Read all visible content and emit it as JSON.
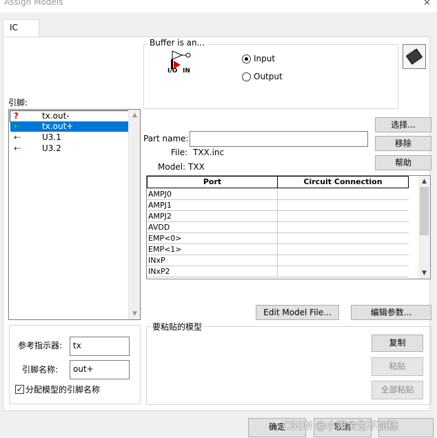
{
  "window": {
    "title": "Assign Models"
  },
  "tabs": [
    {
      "label": "IC"
    }
  ],
  "buffer": {
    "group_label": "Buffer is an...",
    "diagram_left_label": "I/O",
    "diagram_right_label": "IN",
    "options": [
      {
        "label": "Input",
        "checked": true
      },
      {
        "label": "Output",
        "checked": false
      }
    ]
  },
  "pins": {
    "label": "引脚:",
    "items": [
      {
        "name": "tx.out-",
        "icon": "question-icon",
        "icon_char": "?",
        "icon_color": "#e00000",
        "selected": false,
        "focused": true
      },
      {
        "name": "tx.out+",
        "icon": "arrow-left-icon",
        "icon_char": "⇠",
        "icon_color": "#3cc33c",
        "selected": true,
        "focused": false
      },
      {
        "name": "U3.1",
        "icon": "arrow-left-icon",
        "icon_char": "⇠",
        "icon_color": "#1a7a1a",
        "selected": false,
        "focused": false
      },
      {
        "name": "U3.2",
        "icon": "arrow-left-icon",
        "icon_char": "⇠",
        "icon_color": "#1a7a1a",
        "selected": false,
        "focused": false
      }
    ]
  },
  "part": {
    "name_label": "Part name:",
    "name_value": "",
    "file_label": "File:",
    "file_value": "TXX.inc",
    "model_label": "Model:",
    "model_value": "TXX"
  },
  "side_buttons": {
    "select": "选择...",
    "remove": "移除",
    "help": "帮助"
  },
  "table": {
    "columns": [
      "Port",
      "Circuit Connection"
    ],
    "rows": [
      {
        "port": "AMPJ0",
        "connection": ""
      },
      {
        "port": "AMPJ1",
        "connection": ""
      },
      {
        "port": "AMPJ2",
        "connection": ""
      },
      {
        "port": "AVDD",
        "connection": ""
      },
      {
        "port": "EMP<0>",
        "connection": ""
      },
      {
        "port": "EMP<1>",
        "connection": ""
      },
      {
        "port": "INxP",
        "connection": ""
      },
      {
        "port": "INxP2",
        "connection": ""
      }
    ]
  },
  "model_buttons": {
    "edit_model_file": "Edit Model File...",
    "edit_params": "编辑参数..."
  },
  "ref": {
    "refdes_label": "参考指示器:",
    "refdes_value": "tx",
    "pinname_label": "引脚名称:",
    "pinname_value": "out+",
    "assign_checkbox_label": "分配模型的引脚名称",
    "assign_checked": true
  },
  "paste": {
    "group_label": "要粘贴的模型",
    "copy": "复制",
    "paste": "粘贴",
    "paste_all": "全部粘贴"
  },
  "footer": {
    "ok": "确定",
    "cancel": "取消",
    "watermark": "CSDN @小蝌余生不加糖"
  },
  "colors": {
    "selection": "#0078d7",
    "question": "#e00000",
    "arrow": "#1a7a1a"
  }
}
